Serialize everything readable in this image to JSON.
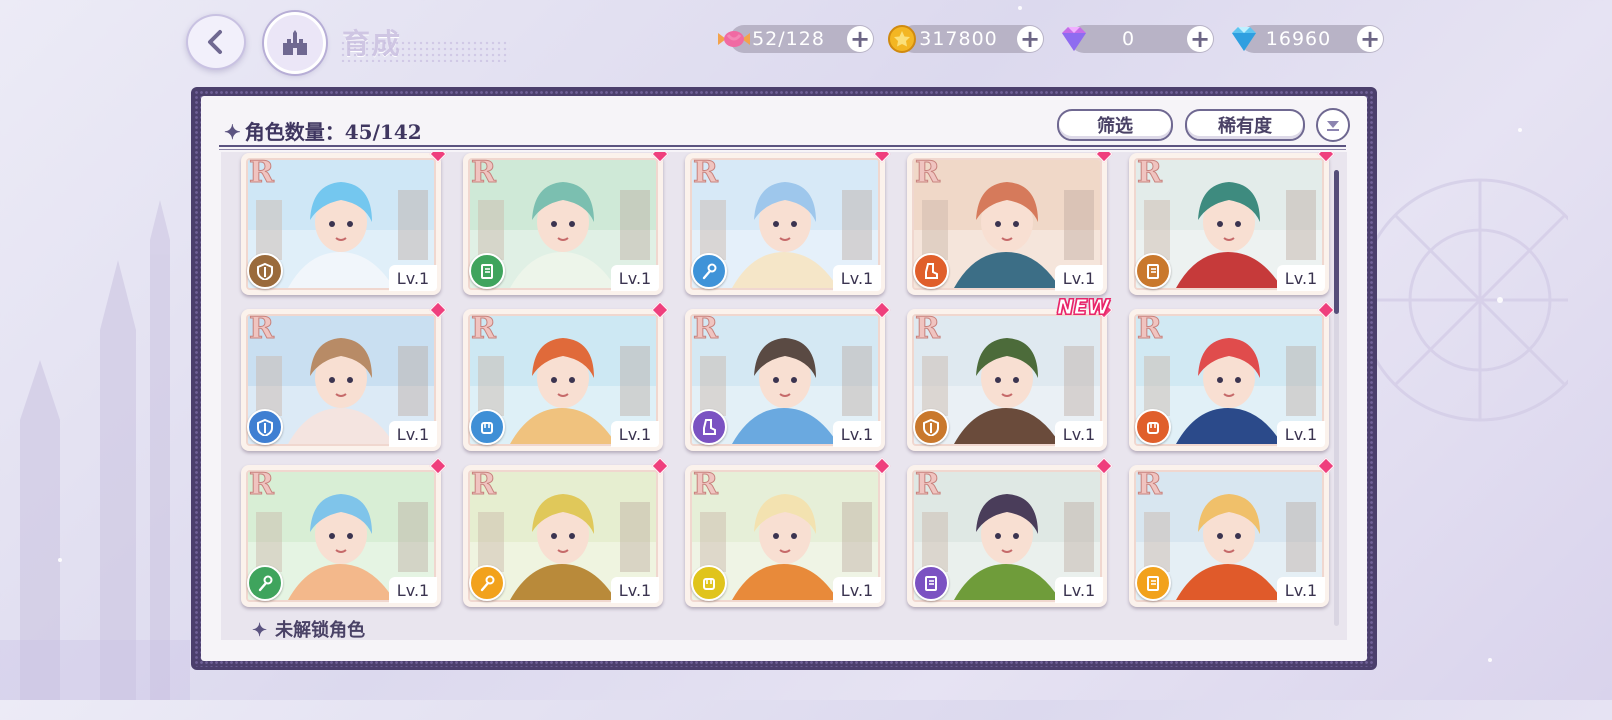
{
  "header": {
    "title": "育成",
    "resources": [
      {
        "name": "stamina",
        "icon": "candy-icon",
        "value": "52/128"
      },
      {
        "name": "coins",
        "icon": "gold-coin-icon",
        "value": "317800"
      },
      {
        "name": "paid-gems",
        "icon": "pink-diamond-icon",
        "value": "0"
      },
      {
        "name": "gems",
        "icon": "blue-diamond-icon",
        "value": "16960"
      }
    ]
  },
  "panel": {
    "count_label": "角色数量：45/142",
    "filter_label": "筛选",
    "rarity_label": "稀有度",
    "locked_label": "未解锁角色"
  },
  "cards": [
    {
      "rank": "R",
      "level": "Lv.1",
      "role": "shield-role-icon",
      "role_color": "#9a6b3c",
      "palette": [
        "#cfe7f6",
        "#74c7ef",
        "#f1f6fb"
      ],
      "new": false
    },
    {
      "rank": "R",
      "level": "Lv.1",
      "role": "book-role-icon",
      "role_color": "#3fa45d",
      "palette": [
        "#cfe9d7",
        "#7bbfb0",
        "#edf5ea"
      ],
      "new": false
    },
    {
      "rank": "R",
      "level": "Lv.1",
      "role": "staff-role-icon",
      "role_color": "#3f93d8",
      "palette": [
        "#d7e9f7",
        "#9ec7ec",
        "#f5e6c8"
      ],
      "new": false
    },
    {
      "rank": "R",
      "level": "Lv.1",
      "role": "boot-role-icon",
      "role_color": "#e05f2b",
      "palette": [
        "#f0d8c8",
        "#d67a5b",
        "#3c6e86"
      ],
      "new": false
    },
    {
      "rank": "R",
      "level": "Lv.1",
      "role": "book-role-icon",
      "role_color": "#c9782c",
      "palette": [
        "#e3ecea",
        "#3e8b7f",
        "#c63a3a"
      ],
      "new": false
    },
    {
      "rank": "R",
      "level": "Lv.1",
      "role": "shield-role-icon",
      "role_color": "#3f7fd2",
      "palette": [
        "#c9dff1",
        "#b88b66",
        "#f4e4e0"
      ],
      "new": false
    },
    {
      "rank": "R",
      "level": "Lv.1",
      "role": "fist-role-icon",
      "role_color": "#3f8fd6",
      "palette": [
        "#cde8f3",
        "#e06a3a",
        "#f0c27e"
      ],
      "new": false
    },
    {
      "rank": "R",
      "level": "Lv.1",
      "role": "boot-role-icon",
      "role_color": "#7b52c2",
      "palette": [
        "#d4e8f3",
        "#5a4a43",
        "#6aa9e0"
      ],
      "new": false
    },
    {
      "rank": "R",
      "level": "Lv.1",
      "role": "shield-role-icon",
      "role_color": "#c9782c",
      "palette": [
        "#dfe9f0",
        "#4c6b3a",
        "#6a4b3b"
      ],
      "new": true
    },
    {
      "rank": "R",
      "level": "Lv.1",
      "role": "fist-role-icon",
      "role_color": "#e05f2b",
      "palette": [
        "#d1e9f3",
        "#e04c4c",
        "#2b4a8a"
      ],
      "new": false
    },
    {
      "rank": "R",
      "level": "Lv.1",
      "role": "staff-role-icon",
      "role_color": "#3fa45d",
      "palette": [
        "#d8eed5",
        "#7fc4ea",
        "#f3b88b"
      ],
      "new": false
    },
    {
      "rank": "R",
      "level": "Lv.1",
      "role": "staff-role-icon",
      "role_color": "#f2a21c",
      "palette": [
        "#e6eed0",
        "#e0c85a",
        "#b98a3a"
      ],
      "new": false
    },
    {
      "rank": "R",
      "level": "Lv.1",
      "role": "fist-role-icon",
      "role_color": "#e0c41c",
      "palette": [
        "#e6efd8",
        "#f3e2b0",
        "#e88a3a"
      ],
      "new": false
    },
    {
      "rank": "R",
      "level": "Lv.1",
      "role": "book-role-icon",
      "role_color": "#7b52c2",
      "palette": [
        "#dfe8e4",
        "#4a3d5a",
        "#6f9c3a"
      ],
      "new": false
    },
    {
      "rank": "R",
      "level": "Lv.1",
      "role": "book-role-icon",
      "role_color": "#f2a21c",
      "palette": [
        "#d8e6f0",
        "#f0c06a",
        "#e05a2a"
      ],
      "new": false
    }
  ],
  "new_badge_text": "NEW"
}
